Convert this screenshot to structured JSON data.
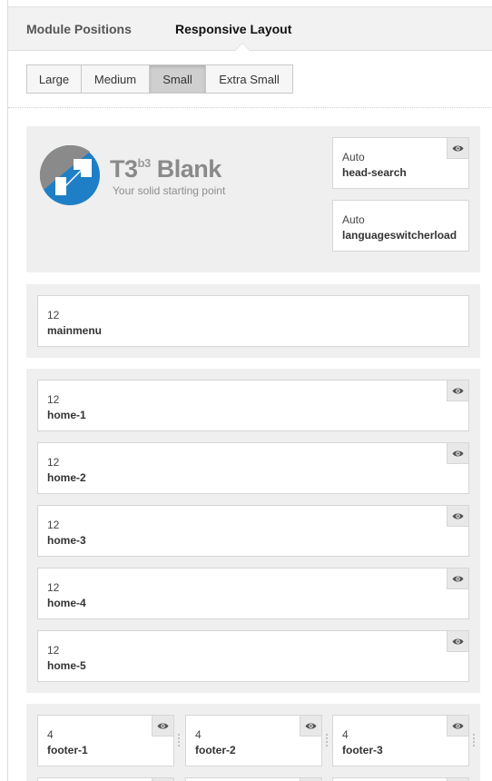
{
  "tabs": [
    {
      "label": "Module Positions",
      "active": false
    },
    {
      "label": "Responsive Layout",
      "active": true
    }
  ],
  "devices": [
    {
      "label": "Large",
      "selected": false
    },
    {
      "label": "Medium",
      "selected": false
    },
    {
      "label": "Small",
      "selected": true
    },
    {
      "label": "Extra Small",
      "selected": false
    }
  ],
  "logo": {
    "brand_main": "T3",
    "brand_sup": "b3",
    "brand_word": "Blank",
    "tagline": "Your solid starting point"
  },
  "header_positions": [
    {
      "width": "Auto",
      "name": "head-search",
      "visibility_toggle": true
    },
    {
      "width": "Auto",
      "name": "languageswitcherload",
      "visibility_toggle": false
    }
  ],
  "mainmenu": {
    "width": "12",
    "name": "mainmenu"
  },
  "home_positions": [
    {
      "width": "12",
      "name": "home-1"
    },
    {
      "width": "12",
      "name": "home-2"
    },
    {
      "width": "12",
      "name": "home-3"
    },
    {
      "width": "12",
      "name": "home-4"
    },
    {
      "width": "12",
      "name": "home-5"
    }
  ],
  "footer_positions": [
    {
      "width": "4",
      "name": "footer-1"
    },
    {
      "width": "4",
      "name": "footer-2"
    },
    {
      "width": "4",
      "name": "footer-3"
    }
  ],
  "icons": {
    "visibility": "eye-icon",
    "resize": "grip-icon",
    "logo": "t3-arrow-logo-icon"
  },
  "colors": {
    "logo_blue": "#1f7fc6",
    "logo_gray": "#8a8a8a",
    "section_bg": "#efefef",
    "selected_btn": "#cfcfcf"
  }
}
